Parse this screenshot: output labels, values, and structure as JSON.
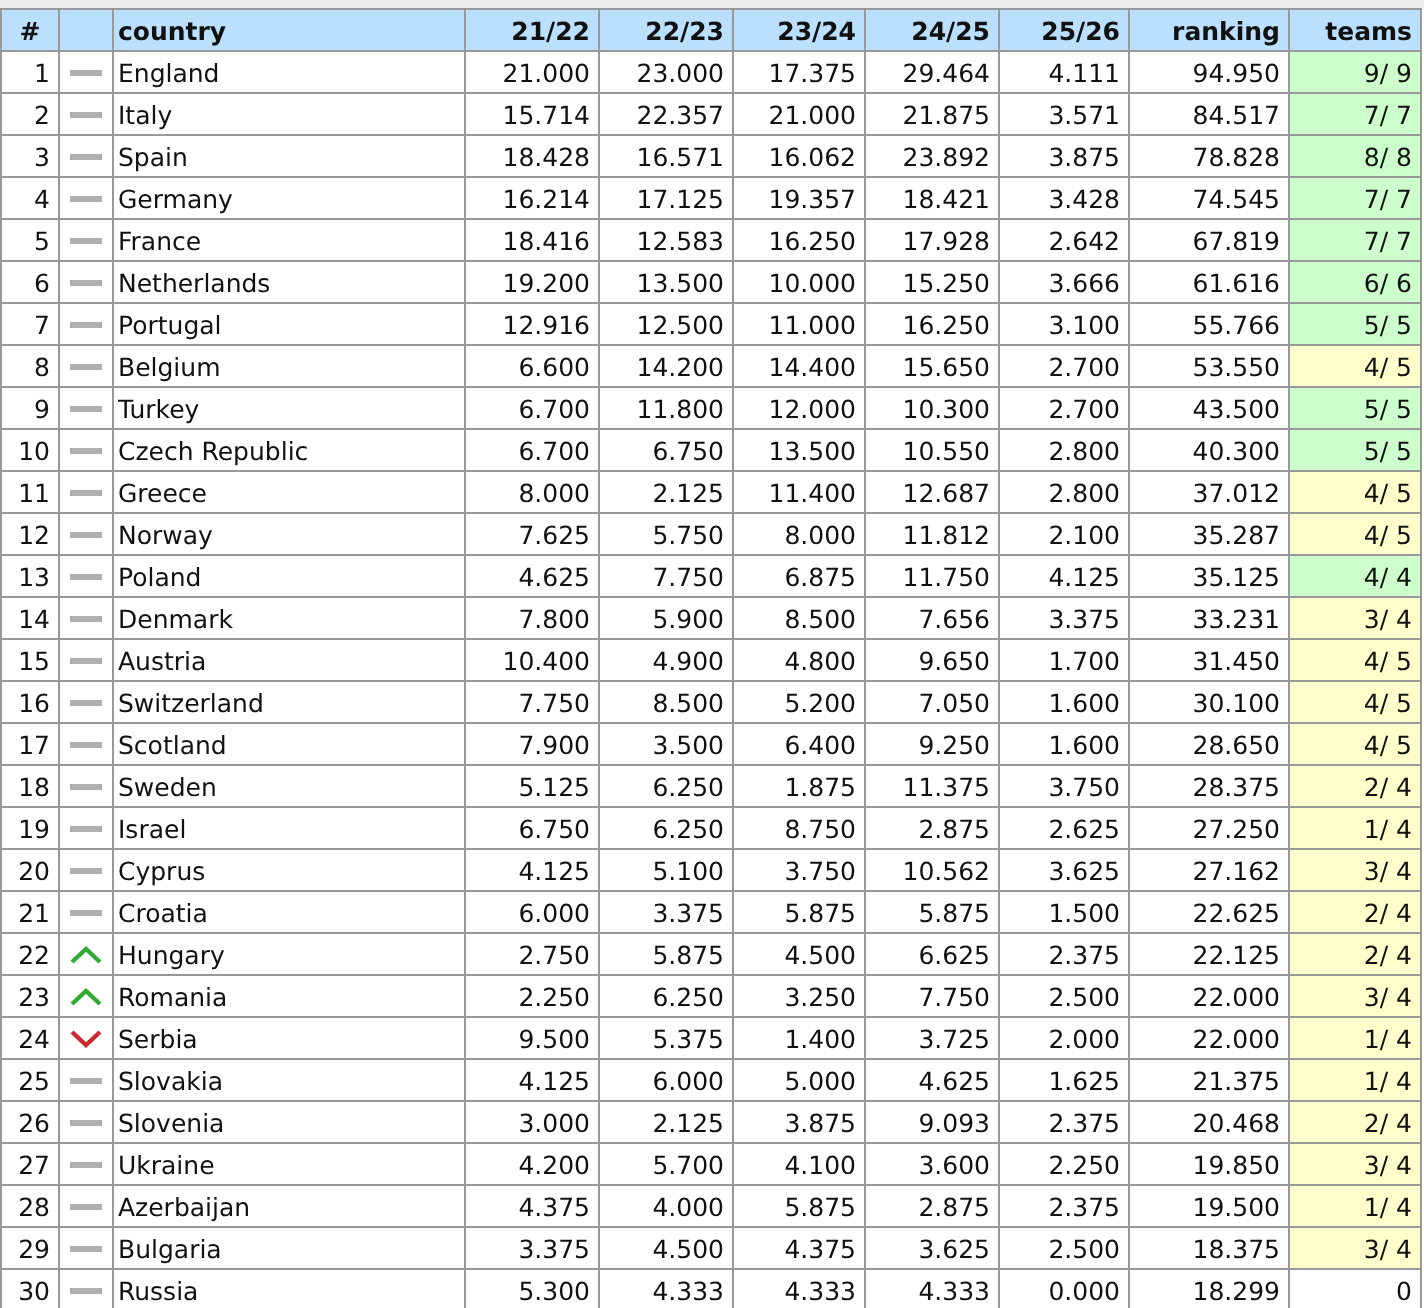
{
  "table": {
    "columns": [
      "#",
      "",
      "country",
      "21/22",
      "22/23",
      "23/24",
      "24/25",
      "25/26",
      "ranking",
      "teams"
    ],
    "rows": [
      {
        "rank": "1",
        "trend": {
          "kind": "same"
        },
        "country": "England",
        "values": [
          "21.000",
          "23.000",
          "17.375",
          "29.464",
          "4.111"
        ],
        "ranking": "94.950",
        "teams": "9/ 9",
        "color": "#ccffcc"
      },
      {
        "rank": "2",
        "trend": {
          "kind": "same"
        },
        "country": "Italy",
        "values": [
          "15.714",
          "22.357",
          "21.000",
          "21.875",
          "3.571"
        ],
        "ranking": "84.517",
        "teams": "7/ 7",
        "color": "#ccffcc"
      },
      {
        "rank": "3",
        "trend": {
          "kind": "same"
        },
        "country": "Spain",
        "values": [
          "18.428",
          "16.571",
          "16.062",
          "23.892",
          "3.875"
        ],
        "ranking": "78.828",
        "teams": "8/ 8",
        "color": "#ccffcc"
      },
      {
        "rank": "4",
        "trend": {
          "kind": "same"
        },
        "country": "Germany",
        "values": [
          "16.214",
          "17.125",
          "19.357",
          "18.421",
          "3.428"
        ],
        "ranking": "74.545",
        "teams": "7/ 7",
        "color": "#ccffcc"
      },
      {
        "rank": "5",
        "trend": {
          "kind": "same"
        },
        "country": "France",
        "values": [
          "18.416",
          "12.583",
          "16.250",
          "17.928",
          "2.642"
        ],
        "ranking": "67.819",
        "teams": "7/ 7",
        "color": "#ccffcc"
      },
      {
        "rank": "6",
        "trend": {
          "kind": "same"
        },
        "country": "Netherlands",
        "values": [
          "19.200",
          "13.500",
          "10.000",
          "15.250",
          "3.666"
        ],
        "ranking": "61.616",
        "teams": "6/ 6",
        "color": "#ccffcc"
      },
      {
        "rank": "7",
        "trend": {
          "kind": "same"
        },
        "country": "Portugal",
        "values": [
          "12.916",
          "12.500",
          "11.000",
          "16.250",
          "3.100"
        ],
        "ranking": "55.766",
        "teams": "5/ 5",
        "color": "#ccffcc"
      },
      {
        "rank": "8",
        "trend": {
          "kind": "same"
        },
        "country": "Belgium",
        "values": [
          "6.600",
          "14.200",
          "14.400",
          "15.650",
          "2.700"
        ],
        "ranking": "53.550",
        "teams": "4/ 5",
        "color": "#ffffcc"
      },
      {
        "rank": "9",
        "trend": {
          "kind": "same"
        },
        "country": "Turkey",
        "values": [
          "6.700",
          "11.800",
          "12.000",
          "10.300",
          "2.700"
        ],
        "ranking": "43.500",
        "teams": "5/ 5",
        "color": "#ccffcc"
      },
      {
        "rank": "10",
        "trend": {
          "kind": "same"
        },
        "country": "Czech Republic",
        "values": [
          "6.700",
          "6.750",
          "13.500",
          "10.550",
          "2.800"
        ],
        "ranking": "40.300",
        "teams": "5/ 5",
        "color": "#ccffcc"
      },
      {
        "rank": "11",
        "trend": {
          "kind": "same"
        },
        "country": "Greece",
        "values": [
          "8.000",
          "2.125",
          "11.400",
          "12.687",
          "2.800"
        ],
        "ranking": "37.012",
        "teams": "4/ 5",
        "color": "#ffffcc"
      },
      {
        "rank": "12",
        "trend": {
          "kind": "same"
        },
        "country": "Norway",
        "values": [
          "7.625",
          "5.750",
          "8.000",
          "11.812",
          "2.100"
        ],
        "ranking": "35.287",
        "teams": "4/ 5",
        "color": "#ffffcc"
      },
      {
        "rank": "13",
        "trend": {
          "kind": "same"
        },
        "country": "Poland",
        "values": [
          "4.625",
          "7.750",
          "6.875",
          "11.750",
          "4.125"
        ],
        "ranking": "35.125",
        "teams": "4/ 4",
        "color": "#ccffcc"
      },
      {
        "rank": "14",
        "trend": {
          "kind": "same"
        },
        "country": "Denmark",
        "values": [
          "7.800",
          "5.900",
          "8.500",
          "7.656",
          "3.375"
        ],
        "ranking": "33.231",
        "teams": "3/ 4",
        "color": "#ffffcc"
      },
      {
        "rank": "15",
        "trend": {
          "kind": "same"
        },
        "country": "Austria",
        "values": [
          "10.400",
          "4.900",
          "4.800",
          "9.650",
          "1.700"
        ],
        "ranking": "31.450",
        "teams": "4/ 5",
        "color": "#ffffcc"
      },
      {
        "rank": "16",
        "trend": {
          "kind": "same"
        },
        "country": "Switzerland",
        "values": [
          "7.750",
          "8.500",
          "5.200",
          "7.050",
          "1.600"
        ],
        "ranking": "30.100",
        "teams": "4/ 5",
        "color": "#ffffcc"
      },
      {
        "rank": "17",
        "trend": {
          "kind": "same"
        },
        "country": "Scotland",
        "values": [
          "7.900",
          "3.500",
          "6.400",
          "9.250",
          "1.600"
        ],
        "ranking": "28.650",
        "teams": "4/ 5",
        "color": "#ffffcc"
      },
      {
        "rank": "18",
        "trend": {
          "kind": "same"
        },
        "country": "Sweden",
        "values": [
          "5.125",
          "6.250",
          "1.875",
          "11.375",
          "3.750"
        ],
        "ranking": "28.375",
        "teams": "2/ 4",
        "color": "#ffffcc"
      },
      {
        "rank": "19",
        "trend": {
          "kind": "same"
        },
        "country": "Israel",
        "values": [
          "6.750",
          "6.250",
          "8.750",
          "2.875",
          "2.625"
        ],
        "ranking": "27.250",
        "teams": "1/ 4",
        "color": "#ffffcc"
      },
      {
        "rank": "20",
        "trend": {
          "kind": "same"
        },
        "country": "Cyprus",
        "values": [
          "4.125",
          "5.100",
          "3.750",
          "10.562",
          "3.625"
        ],
        "ranking": "27.162",
        "teams": "3/ 4",
        "color": "#ffffcc"
      },
      {
        "rank": "21",
        "trend": {
          "kind": "same"
        },
        "country": "Croatia",
        "values": [
          "6.000",
          "3.375",
          "5.875",
          "5.875",
          "1.500"
        ],
        "ranking": "22.625",
        "teams": "2/ 4",
        "color": "#ffffcc"
      },
      {
        "rank": "22",
        "trend": {
          "kind": "up"
        },
        "country": "Hungary",
        "values": [
          "2.750",
          "5.875",
          "4.500",
          "6.625",
          "2.375"
        ],
        "ranking": "22.125",
        "teams": "2/ 4",
        "color": "#ffffcc"
      },
      {
        "rank": "23",
        "trend": {
          "kind": "up"
        },
        "country": "Romania",
        "values": [
          "2.250",
          "6.250",
          "3.250",
          "7.750",
          "2.500"
        ],
        "ranking": "22.000",
        "teams": "3/ 4",
        "color": "#ffffcc"
      },
      {
        "rank": "24",
        "trend": {
          "kind": "down"
        },
        "country": "Serbia",
        "values": [
          "9.500",
          "5.375",
          "1.400",
          "3.725",
          "2.000"
        ],
        "ranking": "22.000",
        "teams": "1/ 4",
        "color": "#ffffcc"
      },
      {
        "rank": "25",
        "trend": {
          "kind": "same"
        },
        "country": "Slovakia",
        "values": [
          "4.125",
          "6.000",
          "5.000",
          "4.625",
          "1.625"
        ],
        "ranking": "21.375",
        "teams": "1/ 4",
        "color": "#ffffcc"
      },
      {
        "rank": "26",
        "trend": {
          "kind": "same"
        },
        "country": "Slovenia",
        "values": [
          "3.000",
          "2.125",
          "3.875",
          "9.093",
          "2.375"
        ],
        "ranking": "20.468",
        "teams": "2/ 4",
        "color": "#ffffcc"
      },
      {
        "rank": "27",
        "trend": {
          "kind": "same"
        },
        "country": "Ukraine",
        "values": [
          "4.200",
          "5.700",
          "4.100",
          "3.600",
          "2.250"
        ],
        "ranking": "19.850",
        "teams": "3/ 4",
        "color": "#ffffcc"
      },
      {
        "rank": "28",
        "trend": {
          "kind": "same"
        },
        "country": "Azerbaijan",
        "values": [
          "4.375",
          "4.000",
          "5.875",
          "2.875",
          "2.375"
        ],
        "ranking": "19.500",
        "teams": "1/ 4",
        "color": "#ffffcc"
      },
      {
        "rank": "29",
        "trend": {
          "kind": "same"
        },
        "country": "Bulgaria",
        "values": [
          "3.375",
          "4.500",
          "4.375",
          "3.625",
          "2.500"
        ],
        "ranking": "18.375",
        "teams": "3/ 4",
        "color": "#ffffcc"
      },
      {
        "rank": "30",
        "trend": {
          "kind": "same"
        },
        "country": "Russia",
        "values": [
          "5.300",
          "4.333",
          "4.333",
          "4.333",
          "0.000"
        ],
        "ranking": "18.299",
        "teams": "0",
        "color": "#ffffff"
      }
    ]
  }
}
